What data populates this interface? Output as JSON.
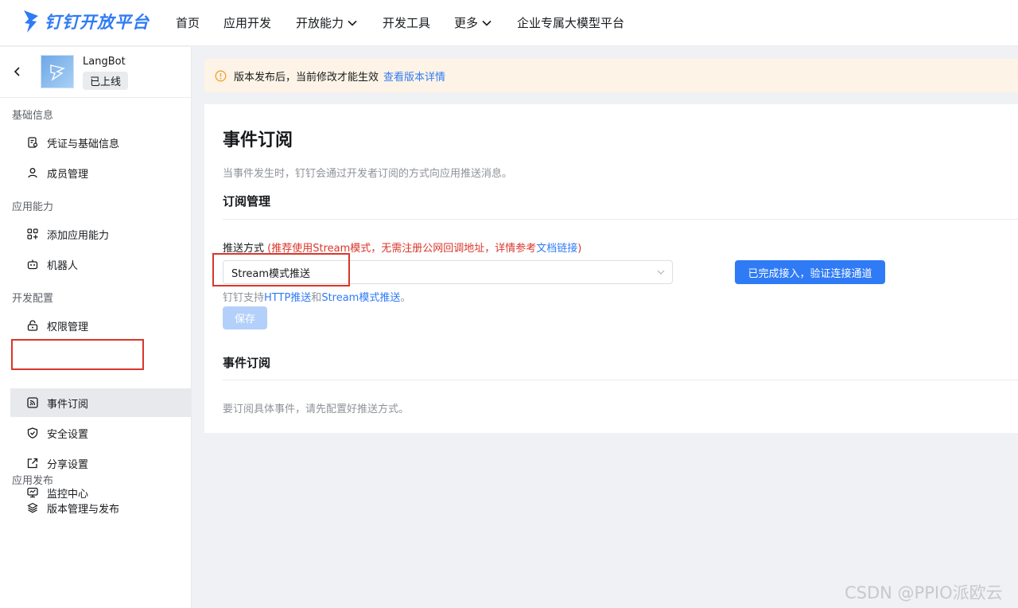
{
  "brand": {
    "name": "钉钉开放平台",
    "color": "#2f7bf5"
  },
  "topnav": {
    "items": [
      {
        "label": "首页"
      },
      {
        "label": "应用开发"
      },
      {
        "label": "开放能力"
      },
      {
        "label": "开发工具"
      },
      {
        "label": "更多"
      },
      {
        "label": "企业专属大模型平台"
      }
    ]
  },
  "app": {
    "name": "LangBot",
    "status": "已上线"
  },
  "sidebar": {
    "groups": [
      {
        "title": "基础信息",
        "items": [
          {
            "label": "凭证与基础信息",
            "icon": "credential-icon"
          },
          {
            "label": "成员管理",
            "icon": "user-icon"
          }
        ]
      },
      {
        "title": "应用能力",
        "items": [
          {
            "label": "添加应用能力",
            "icon": "apps-add-icon"
          },
          {
            "label": "机器人",
            "icon": "robot-icon"
          }
        ]
      },
      {
        "title": "开发配置",
        "items": [
          {
            "label": "权限管理",
            "icon": "lock-icon"
          },
          {
            "label": "事件订阅",
            "icon": "rss-icon"
          },
          {
            "label": "安全设置",
            "icon": "shield-icon"
          },
          {
            "label": "分享设置",
            "icon": "share-icon"
          },
          {
            "label": "监控中心",
            "icon": "monitor-icon"
          }
        ]
      },
      {
        "title": "应用发布",
        "items": [
          {
            "label": "版本管理与发布",
            "icon": "layers-icon"
          }
        ]
      }
    ],
    "active_item": "事件订阅"
  },
  "notice": {
    "text": "版本发布后，当前修改才能生效",
    "link": "查看版本详情"
  },
  "main": {
    "title": "事件订阅",
    "description": "当事件发生时，钉钉会通过开发者订阅的方式向应用推送消息。",
    "subscription_section": "订阅管理",
    "push_label": "推送方式",
    "push_hint_prefix": "(推荐使用Stream模式，无需注册公网回调地址，详情参考",
    "push_hint_link": "文档链接",
    "push_hint_suffix": ")",
    "push_mode_value": "Stream模式推送",
    "verify_button": "已完成接入，验证连接通道",
    "support_prefix": "钉钉支持",
    "support_http": "HTTP推送",
    "support_and": "和",
    "support_stream": "Stream模式推送",
    "support_suffix": "。",
    "save_button": "保存",
    "event_section": "事件订阅",
    "empty_hint": "要订阅具体事件，请先配置好推送方式。"
  },
  "watermark": "CSDN @PPIO派欧云",
  "colors": {
    "accent": "#2f7bf5",
    "highlight_box": "#d9362b",
    "notice_bg": "#fdf3e6",
    "hint_red": "#d9362b"
  }
}
